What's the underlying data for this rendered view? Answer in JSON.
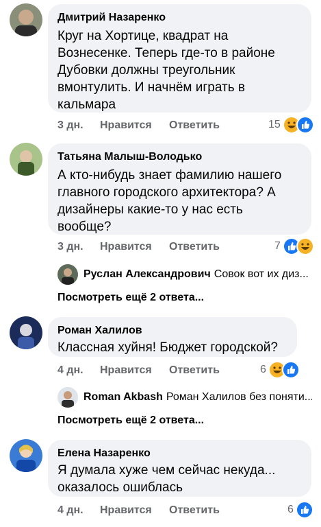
{
  "comments": [
    {
      "author": "Дмитрий Назаренко",
      "lines": [
        "Круг на Хортице, квадрат на",
        "Вознесенке. Теперь где-то в районе",
        "Дубовки должны треугольник",
        "вмонтулить. И начнём играть в",
        "кальмара"
      ],
      "time": "3 дн.",
      "like_label": "Нравится",
      "reply_label": "Ответить",
      "reaction_count": "15",
      "reactions": [
        "haha-icon",
        "like-icon"
      ]
    },
    {
      "author": "Татьяна Малыш-Володько",
      "lines": [
        "А кто-нибудь знает фамилию нашего",
        "главного городского архитектора? А",
        "дизайнеры какие-то у нас есть",
        "вообще?"
      ],
      "time": "3 дн.",
      "like_label": "Нравится",
      "reply_label": "Ответить",
      "reaction_count": "7",
      "reactions": [
        "like-icon",
        "haha-icon"
      ],
      "reply_preview": {
        "name": "Руслан Александрович",
        "text": "Совок вот их диз..."
      },
      "more_replies": "Посмотреть ещё 2 ответа..."
    },
    {
      "author": "Роман Халилов",
      "lines": [
        "Классная хуйня! Бюджет городской?"
      ],
      "time": "4 дн.",
      "like_label": "Нравится",
      "reply_label": "Ответить",
      "reaction_count": "6",
      "reactions": [
        "haha-icon",
        "like-icon"
      ],
      "reply_preview": {
        "name": "Roman Akbash",
        "text": "Роман Халилов без поняти..."
      },
      "more_replies": "Посмотреть ещё 2 ответа..."
    },
    {
      "author": "Елена Назаренко",
      "lines": [
        "Я думала хуже чем сейчас некуда...",
        "оказалось ошиблась"
      ],
      "time": "4 дн.",
      "like_label": "Нравится",
      "reply_label": "Ответить",
      "reaction_count": "6",
      "reactions": [
        "like-icon"
      ]
    }
  ],
  "colors": {
    "bubble": "#f0f2f5",
    "meta_text": "#65676b",
    "like_blue": "#1877f2",
    "haha_yellow": "#f7b125"
  }
}
